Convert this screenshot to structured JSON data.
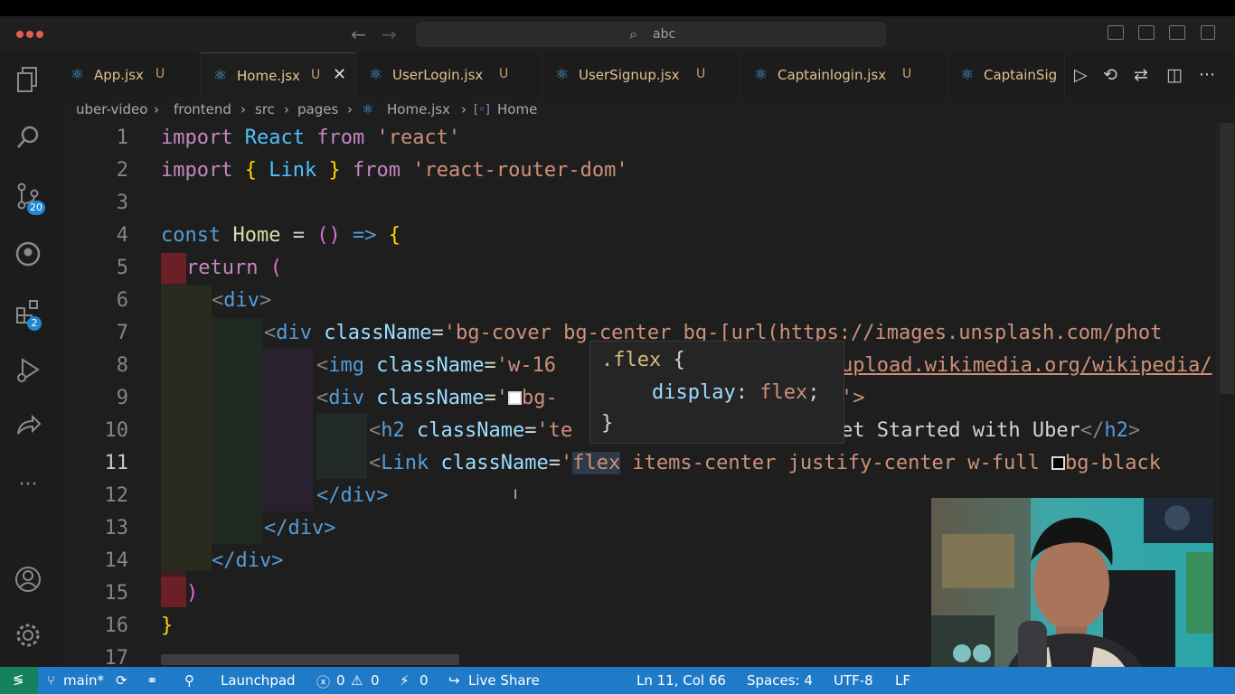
{
  "search": {
    "text": "abc"
  },
  "activity_badges": {
    "source_control": "20",
    "extensions": "2"
  },
  "tabs": [
    {
      "name": "App.jsx",
      "mod": "U"
    },
    {
      "name": "Home.jsx",
      "mod": "U"
    },
    {
      "name": "UserLogin.jsx",
      "mod": "U"
    },
    {
      "name": "UserSignup.jsx",
      "mod": "U"
    },
    {
      "name": "Captainlogin.jsx",
      "mod": "U"
    },
    {
      "name": "CaptainSig"
    }
  ],
  "breadcrumb": [
    "uber-video",
    "frontend",
    "src",
    "pages",
    "Home.jsx",
    "Home"
  ],
  "line_numbers": [
    "1",
    "2",
    "3",
    "4",
    "5",
    "6",
    "7",
    "8",
    "9",
    "10",
    "11",
    "12",
    "13",
    "14",
    "15",
    "16",
    "17"
  ],
  "code": {
    "l1": {
      "kw1": "import",
      "id": "React",
      "kw2": "from",
      "str": "'react'"
    },
    "l2": {
      "kw1": "import",
      "ob": "{",
      "id": "Link",
      "cb": "}",
      "kw2": "from",
      "str": "'react-router-dom'"
    },
    "l4": {
      "kw": "const",
      "id": "Home",
      "eq": "=",
      "paren": "()",
      "arrow": "=>",
      "brace": "{"
    },
    "l5": {
      "kw": "return",
      "paren": "("
    },
    "l6": {
      "open": "<",
      "tag": "div",
      "close": ">"
    },
    "l7": {
      "open": "<",
      "tag": "div",
      "attr": "className",
      "eq": "=",
      "str": "'bg-cover bg-center bg-[url(https://images.unsplash.com/phot"
    },
    "l8": {
      "open": "<",
      "tag": "img",
      "attr": "className",
      "eq": "=",
      "str_a": "'w-16",
      "str_b": "upload.wikimedia.org/wikipedia/"
    },
    "l9": {
      "open": "<",
      "tag": "div",
      "attr": "className",
      "eq": "=",
      "str_a": "'",
      "str_b": "bg-",
      "tail": "'>"
    },
    "l10": {
      "open": "<",
      "tag": "h2",
      "attr": "className",
      "eq": "=",
      "str": "'te",
      "text": "et Started with Uber",
      "close_tag": "</h2>"
    },
    "l11": {
      "open": "<",
      "tag": "Link",
      "attr": "className",
      "eq": "=",
      "str_a": "'",
      "hl": "flex",
      "str_b": " items-center justify-center w-full ",
      "str_c": "bg-black"
    },
    "l12": {
      "close": "</div>"
    },
    "l13": {
      "close": "</div>"
    },
    "l14": {
      "close": "</div>"
    },
    "l15": {
      "paren": ")"
    },
    "l16": {
      "brace": "}"
    }
  },
  "hover": {
    "selector": ".flex",
    "open": "{",
    "prop": "display",
    "value": "flex",
    "close": "}"
  },
  "status": {
    "branch": "main*",
    "launchpad": "Launchpad",
    "errors": "0",
    "warnings": "0",
    "ports": "0",
    "live_share": "Live Share",
    "position": "Ln 11, Col 66",
    "spaces": "Spaces: 4",
    "encoding": "UTF-8",
    "eol": "LF"
  },
  "colors": {
    "status_bar": "#1f7ac7",
    "editor_bg": "#1e1e1e",
    "accent": "#4aa3d8"
  }
}
